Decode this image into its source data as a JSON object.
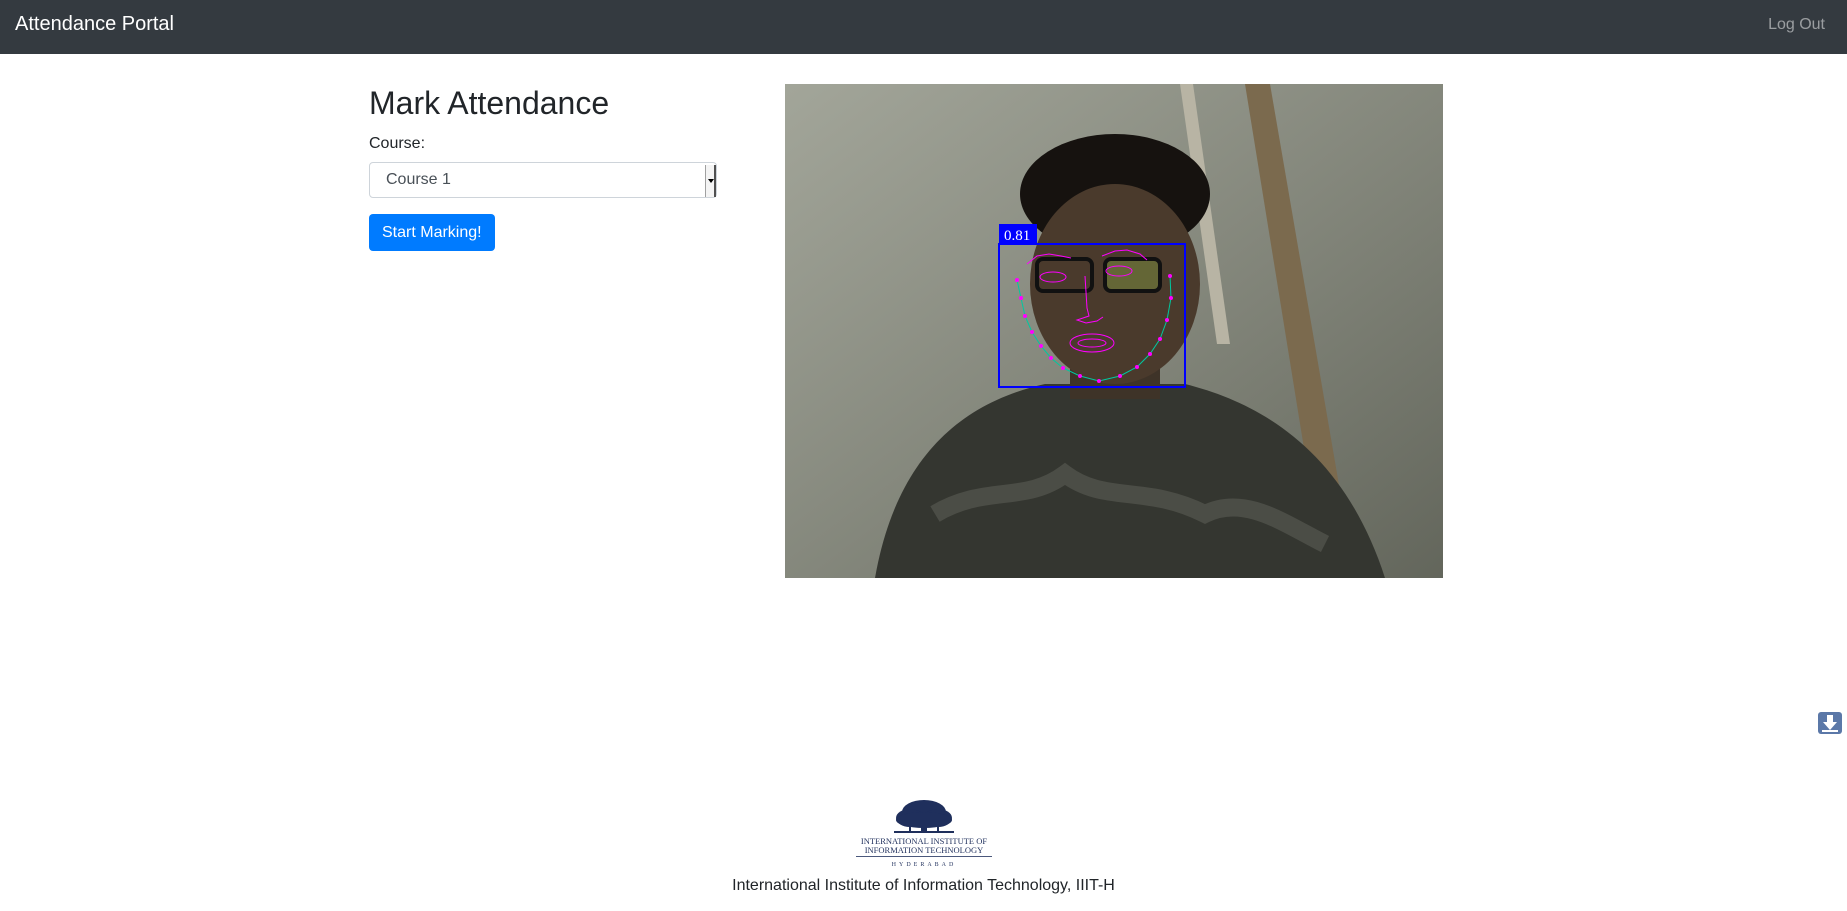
{
  "navbar": {
    "brand": "Attendance Portal",
    "logout_label": "Log Out",
    "background_color": "#343a40"
  },
  "main": {
    "title": "Mark Attendance",
    "course_label": "Course:",
    "course_select": {
      "selected": "Course 1"
    },
    "start_button_label": "Start Marking!",
    "accent_color": "#007bff"
  },
  "camera": {
    "detection_score": "0.81",
    "box_color": "#0000ff",
    "landmark_color": "#ff00ff"
  },
  "footer": {
    "logo_line1": "INTERNATIONAL INSTITUTE OF",
    "logo_line2": "INFORMATION TECHNOLOGY",
    "logo_line3": "HYDERABAD",
    "text": "International Institute of Information Technology, IIIT-H"
  },
  "icons": {
    "download": "download-arrow-icon",
    "dropdown": "chevron-down-icon"
  }
}
